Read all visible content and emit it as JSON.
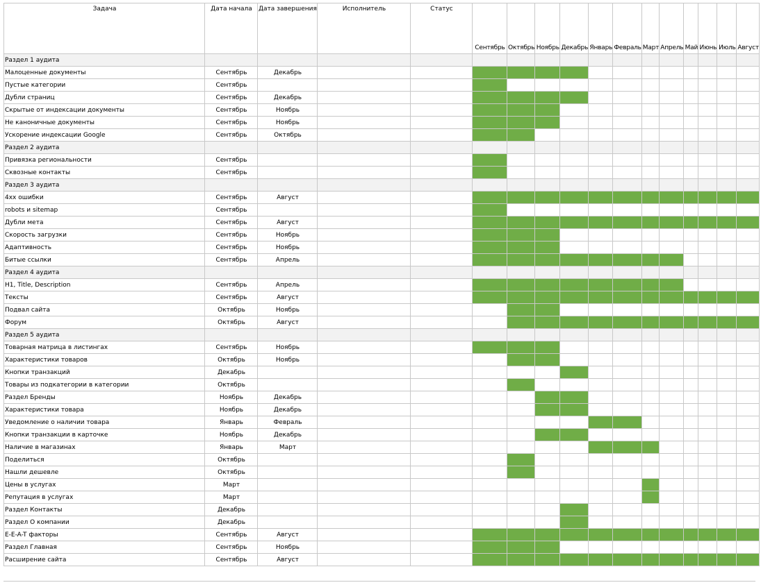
{
  "headers": {
    "task": "Задача",
    "start": "Дата начала",
    "end": "Дата завершения",
    "assignee": "Исполнитель",
    "status": "Статус"
  },
  "months": [
    "Сентябрь",
    "Октябрь",
    "Ноябрь",
    "Декабрь",
    "Январь",
    "Февраль",
    "Март",
    "Апрель",
    "Май",
    "Июнь",
    "Июль",
    "Август"
  ],
  "highlight_color": "#70ad47",
  "rows": [
    {
      "type": "section",
      "task": "Раздел 1 аудита"
    },
    {
      "type": "task",
      "task": "Малоценные документы",
      "start": "Сентябрь",
      "end": "Декабрь",
      "bar": [
        0,
        3
      ]
    },
    {
      "type": "task",
      "task": "Пустые категории",
      "start": "Сентябрь",
      "end": "",
      "bar": [
        0,
        0
      ]
    },
    {
      "type": "task",
      "task": "Дубли страниц",
      "start": "Сентябрь",
      "end": "Декабрь",
      "bar": [
        0,
        3
      ]
    },
    {
      "type": "task",
      "task": "Скрытые от индексации документы",
      "start": "Сентябрь",
      "end": "Ноябрь",
      "bar": [
        0,
        2
      ]
    },
    {
      "type": "task",
      "task": "Не каноничные документы",
      "start": "Сентябрь",
      "end": "Ноябрь",
      "bar": [
        0,
        2
      ]
    },
    {
      "type": "task",
      "task": "Ускорение индексации Google",
      "start": "Сентябрь",
      "end": "Октябрь",
      "bar": [
        0,
        1
      ]
    },
    {
      "type": "section",
      "task": "Раздел 2 аудита"
    },
    {
      "type": "task",
      "task": "Привязка региональности",
      "start": "Сентябрь",
      "end": "",
      "bar": [
        0,
        0
      ]
    },
    {
      "type": "task",
      "task": "Сквозные контакты",
      "start": "Сентябрь",
      "end": "",
      "bar": [
        0,
        0
      ]
    },
    {
      "type": "section",
      "task": "Раздел 3 аудита"
    },
    {
      "type": "task",
      "task": "4хх ошибки",
      "start": "Сентябрь",
      "end": "Август",
      "bar": [
        0,
        11
      ]
    },
    {
      "type": "task",
      "task": "robots и sitemap",
      "start": "Сентябрь",
      "end": "",
      "bar": [
        0,
        0
      ]
    },
    {
      "type": "task",
      "task": "Дубли мета",
      "start": "Сентябрь",
      "end": "Август",
      "bar": [
        0,
        11
      ]
    },
    {
      "type": "task",
      "task": "Скорость загрузки",
      "start": "Сентябрь",
      "end": "Ноябрь",
      "bar": [
        0,
        2
      ]
    },
    {
      "type": "task",
      "task": "Адаптивность",
      "start": "Сентябрь",
      "end": "Ноябрь",
      "bar": [
        0,
        2
      ]
    },
    {
      "type": "task",
      "task": "Битые ссылки",
      "start": "Сентябрь",
      "end": "Апрель",
      "bar": [
        0,
        7
      ]
    },
    {
      "type": "section",
      "task": "Раздел 4 аудита"
    },
    {
      "type": "task",
      "task": "H1, Title, Description",
      "start": "Сентябрь",
      "end": "Апрель",
      "bar": [
        0,
        7
      ]
    },
    {
      "type": "task",
      "task": "Тексты",
      "start": "Сентябрь",
      "end": "Август",
      "bar": [
        0,
        11
      ]
    },
    {
      "type": "task",
      "task": "Подвал сайта",
      "start": "Октябрь",
      "end": "Ноябрь",
      "bar": [
        1,
        2
      ]
    },
    {
      "type": "task",
      "task": "Форум",
      "start": "Октябрь",
      "end": "Август",
      "bar": [
        1,
        11
      ]
    },
    {
      "type": "section",
      "task": "Раздел 5 аудита"
    },
    {
      "type": "task",
      "task": "Товарная матрица в листингах",
      "start": "Сентябрь",
      "end": "Ноябрь",
      "bar": [
        0,
        2
      ]
    },
    {
      "type": "task",
      "task": "Характеристики товаров",
      "start": "Октябрь",
      "end": "Ноябрь",
      "bar": [
        1,
        2
      ]
    },
    {
      "type": "task",
      "task": "Кнопки транзакций",
      "start": "Декабрь",
      "end": "",
      "bar": [
        3,
        3
      ]
    },
    {
      "type": "task",
      "task": "Товары из подкатегории в категории",
      "start": "Октябрь",
      "end": "",
      "bar": [
        1,
        1
      ]
    },
    {
      "type": "task",
      "task": "Раздел Бренды",
      "start": "Ноябрь",
      "end": "Декабрь",
      "bar": [
        2,
        3
      ]
    },
    {
      "type": "task",
      "task": "Характеристики товара",
      "start": "Ноябрь",
      "end": "Декабрь",
      "bar": [
        2,
        3
      ]
    },
    {
      "type": "task",
      "task": "Уведомление о наличии товара",
      "start": "Январь",
      "end": "Февраль",
      "bar": [
        4,
        5
      ]
    },
    {
      "type": "task",
      "task": "Кнопки транзакции в карточке",
      "start": "Ноябрь",
      "end": "Декабрь",
      "bar": [
        2,
        3
      ]
    },
    {
      "type": "task",
      "task": "Наличие в магазинах",
      "start": "Январь",
      "end": "Март",
      "bar": [
        4,
        6
      ]
    },
    {
      "type": "task",
      "task": "Поделиться",
      "start": "Октябрь",
      "end": "",
      "bar": [
        1,
        1
      ]
    },
    {
      "type": "task",
      "task": "Нашли дешевле",
      "start": "Октябрь",
      "end": "",
      "bar": [
        1,
        1
      ]
    },
    {
      "type": "task",
      "task": "Цены в услугах",
      "start": "Март",
      "end": "",
      "bar": [
        6,
        6
      ]
    },
    {
      "type": "task",
      "task": "Репутация в услугах",
      "start": "Март",
      "end": "",
      "bar": [
        6,
        6
      ]
    },
    {
      "type": "task",
      "task": "Раздел Контакты",
      "start": "Декабрь",
      "end": "",
      "bar": [
        3,
        3
      ]
    },
    {
      "type": "task",
      "task": "Раздел О компании",
      "start": "Декабрь",
      "end": "",
      "bar": [
        3,
        3
      ]
    },
    {
      "type": "task",
      "task": "E-E-A-T факторы",
      "start": "Сентябрь",
      "end": "Август",
      "bar": [
        0,
        11
      ]
    },
    {
      "type": "task",
      "task": "Раздел Главная",
      "start": "Сентябрь",
      "end": "Ноябрь",
      "bar": [
        0,
        2
      ]
    },
    {
      "type": "task",
      "task": "Расширение сайта",
      "start": "Сентябрь",
      "end": "Август",
      "bar": [
        0,
        11
      ]
    }
  ]
}
